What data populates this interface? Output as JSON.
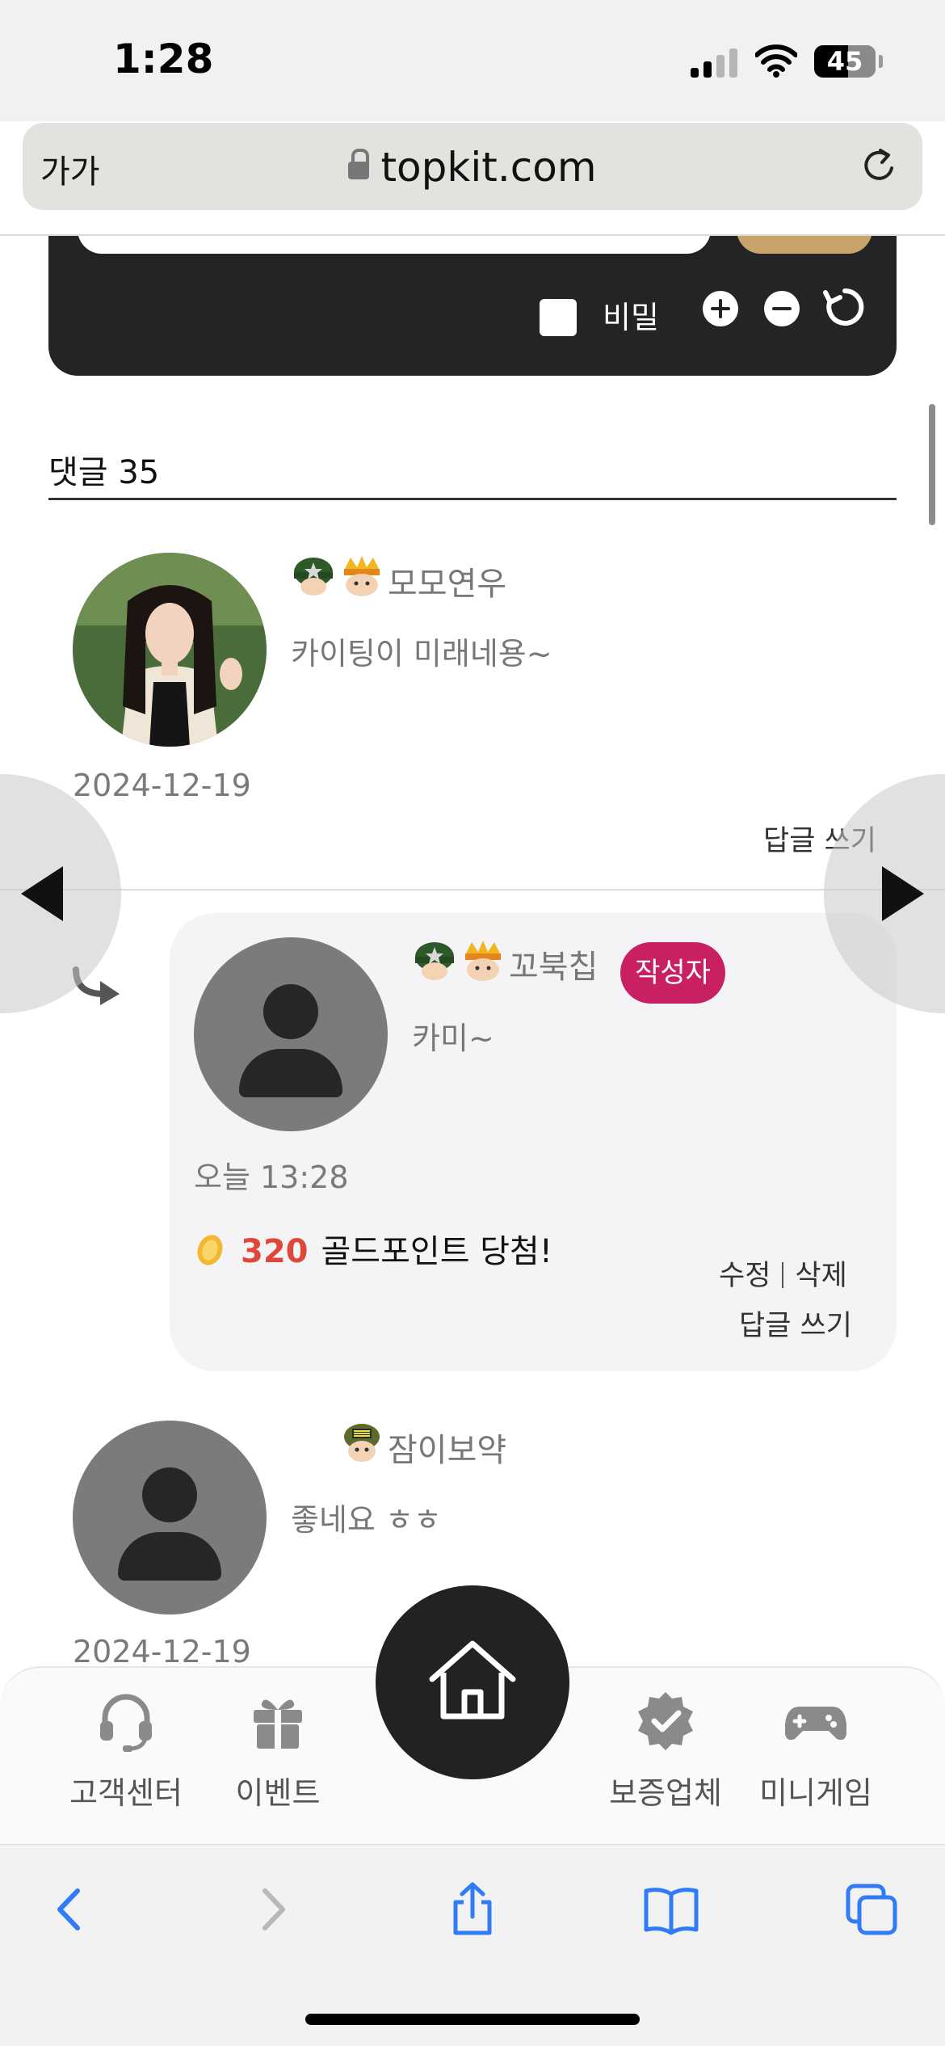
{
  "status_bar": {
    "time": "1:28",
    "battery": "45"
  },
  "browser": {
    "text_size_label": "가가",
    "url": "topkit.com"
  },
  "write_panel": {
    "secret_label": "비밀"
  },
  "comments": {
    "header": "댓글 35",
    "items": [
      {
        "author": "모모연우",
        "text": "카이팅이 미래네용~",
        "date": "2024-12-19",
        "reply_label": "답글 쓰기"
      },
      {
        "author": "꼬북칩",
        "author_badge": "작성자",
        "text": "카미~",
        "date": "오늘 13:28",
        "points": "320",
        "points_text": "골드포인트 당첨!",
        "edit_label": "수정",
        "delete_label": "삭제",
        "reply_label": "답글 쓰기"
      },
      {
        "author": "잠이보약",
        "text": "좋네요 ㅎㅎ",
        "date": "2024-12-19"
      }
    ]
  },
  "tab_bar": {
    "items": [
      {
        "label": "고객센터",
        "icon": "headset-icon"
      },
      {
        "label": "이벤트",
        "icon": "gift-icon"
      },
      {
        "label": "보증업체",
        "icon": "verified-badge-icon"
      },
      {
        "label": "미니게임",
        "icon": "gamepad-icon"
      }
    ],
    "home_icon": "home-icon"
  },
  "colors": {
    "panel_dark": "#242424",
    "author_badge": "#c91f63",
    "points_red": "#e0473b",
    "safari_blue": "#2f7cf6"
  }
}
